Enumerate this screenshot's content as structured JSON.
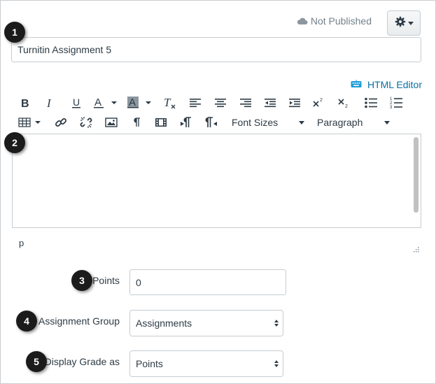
{
  "header": {
    "status_text": "Not Published",
    "status_icon": "cloud-icon",
    "settings_icon": "gear-icon"
  },
  "title_field": {
    "value": "Turnitin Assignment 5"
  },
  "callouts": [
    "1",
    "2",
    "3",
    "4",
    "5"
  ],
  "editor": {
    "html_editor_label": "HTML Editor",
    "font_sizes_label": "Font Sizes",
    "paragraph_label": "Paragraph",
    "path_text": "p",
    "toolbar_row1_icons": [
      "bold-icon",
      "italic-icon",
      "underline-icon",
      "text-color-icon",
      "background-color-icon",
      "clear-formatting-icon",
      "align-left-icon",
      "align-center-icon",
      "align-right-icon",
      "outdent-icon",
      "indent-icon",
      "superscript-icon",
      "subscript-icon",
      "bullet-list-icon",
      "numbered-list-icon"
    ],
    "toolbar_row2_icons": [
      "table-icon",
      "link-icon",
      "unlink-icon",
      "image-icon",
      "paragraph-mark-icon",
      "media-icon",
      "ltr-icon",
      "rtl-icon"
    ]
  },
  "fields": {
    "points_label": "Points",
    "points_value": "0",
    "group_label": "Assignment Group",
    "group_value": "Assignments",
    "display_grade_label": "Display Grade as",
    "display_grade_value": "Points"
  },
  "colors": {
    "link": "#0770a3",
    "text": "#2d3b45",
    "muted": "#73818c",
    "border": "#c7cdd1",
    "badge": "#1b1b1b"
  }
}
